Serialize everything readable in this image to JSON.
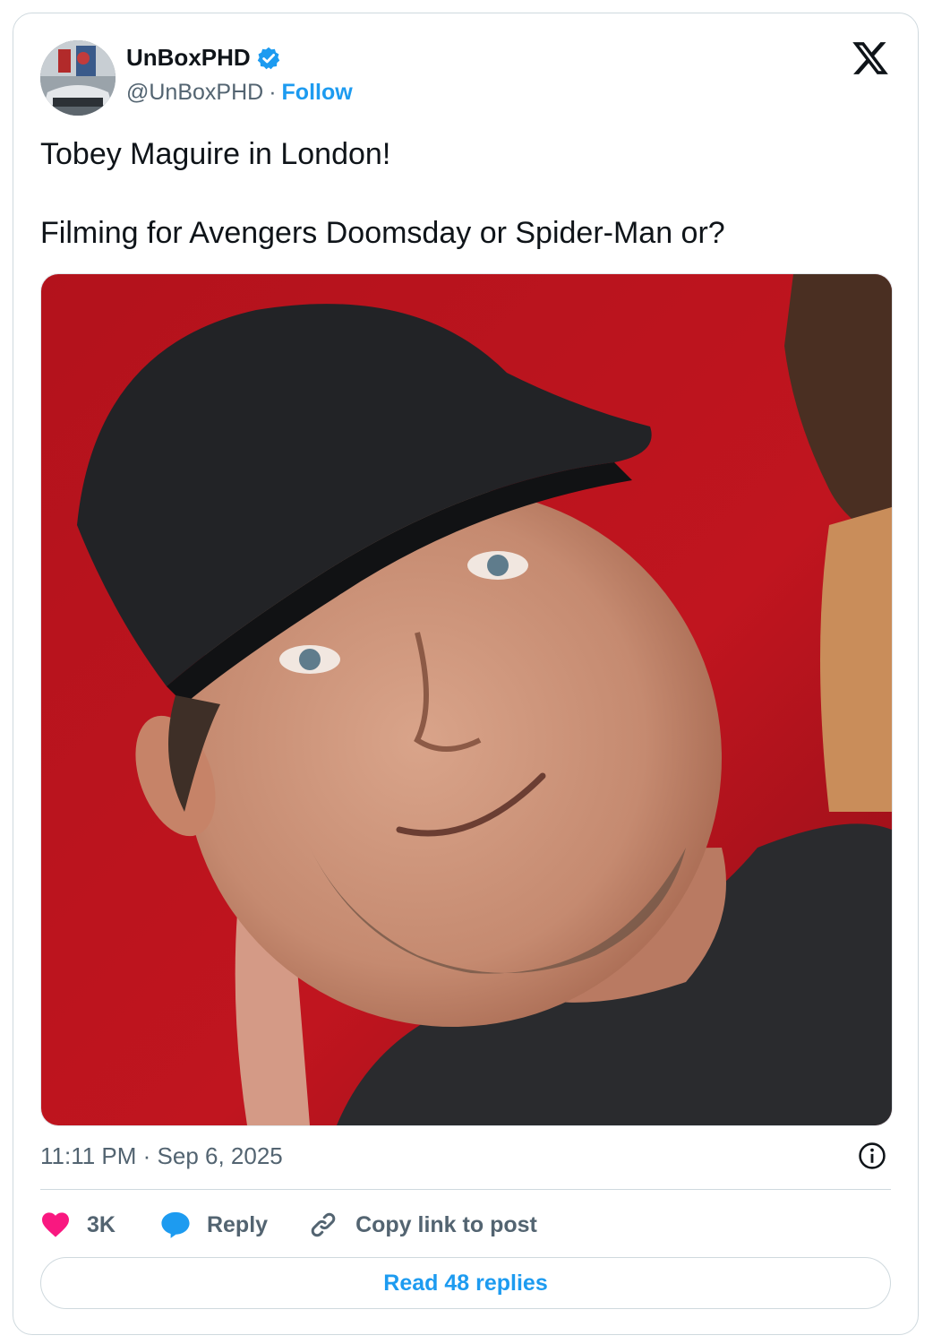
{
  "author": {
    "display_name": "UnBoxPHD",
    "handle": "@UnBoxPHD",
    "separator": "·",
    "follow_label": "Follow",
    "verified": true,
    "avatar_icon": "profile-photo"
  },
  "post": {
    "lines": [
      "Tobey Maguire in London!",
      "Filming for Avengers Doomsday or Spider-Man or?"
    ],
    "media_icon": "photo",
    "timestamp": "11:11 PM · Sep 6, 2025"
  },
  "actions": {
    "like_count": "3K",
    "reply_label": "Reply",
    "copy_link_label": "Copy link to post"
  },
  "footer": {
    "read_replies_label": "Read 48 replies"
  },
  "colors": {
    "accent": "#1d9bf0",
    "like": "#f91880",
    "text": "#0f1419",
    "muted": "#536471",
    "border": "#cfd9de"
  }
}
